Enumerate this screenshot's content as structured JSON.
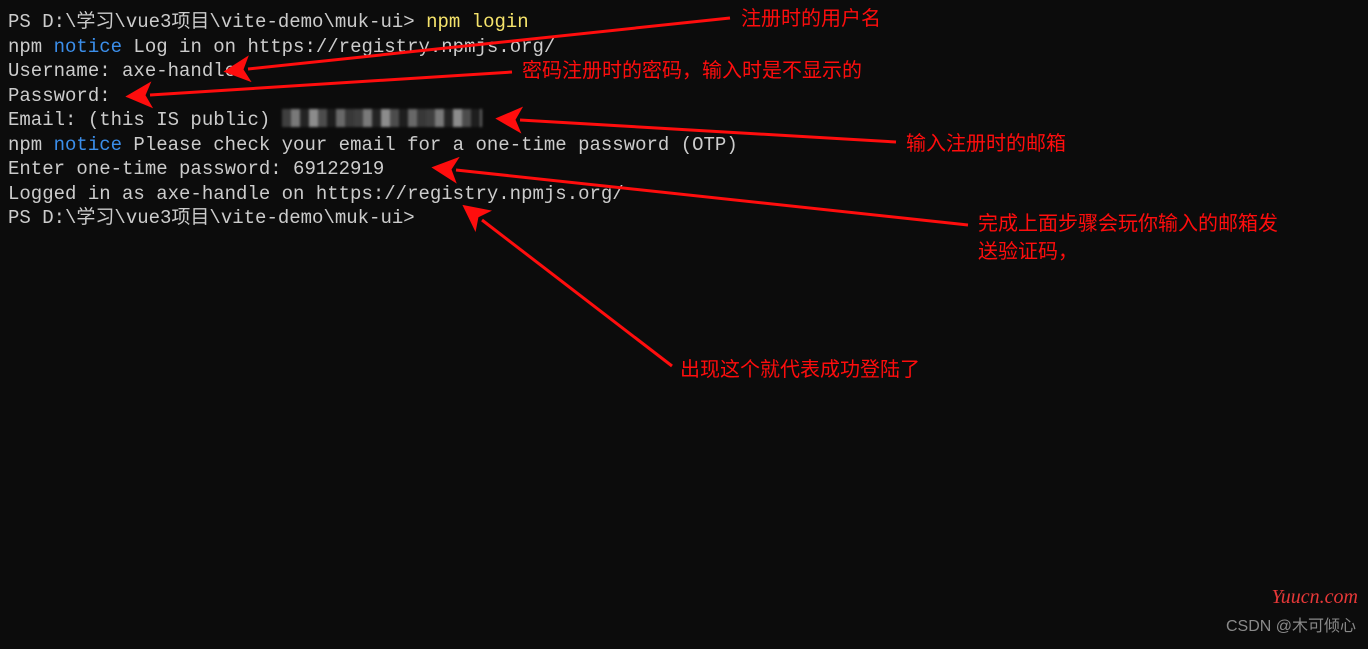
{
  "terminal": {
    "prompt1_ps": "PS ",
    "prompt1_path": "D:\\学习\\vue3项目\\vite-demo\\muk-ui> ",
    "cmd1": "npm login",
    "line2_prefix": "npm ",
    "line2_notice": "notice",
    "line2_rest": " Log in on https://registry.npmjs.org/",
    "line3": "Username: axe-handle",
    "line4": "Password:",
    "line5_prefix": "Email: (this IS public) ",
    "line6_prefix": "npm ",
    "line6_notice": "notice",
    "line6_rest": " Please check your email for a one-time password (OTP)",
    "line7": "Enter one-time password: 69122919",
    "line8": "Logged in as axe-handle on https://registry.npmjs.org/",
    "prompt2_ps": "PS ",
    "prompt2_path": "D:\\学习\\vue3项目\\vite-demo\\muk-ui>"
  },
  "annotations": {
    "a1": "注册时的用户名",
    "a2": "密码注册时的密码，输入时是不显示的",
    "a3": "输入注册时的邮箱",
    "a4_line1": "完成上面步骤会玩你输入的邮箱发",
    "a4_line2": "送验证码，",
    "a5": "出现这个就代表成功登陆了"
  },
  "watermarks": {
    "w1": "Yuucn.com",
    "w2": "CSDN @木可倾心"
  }
}
